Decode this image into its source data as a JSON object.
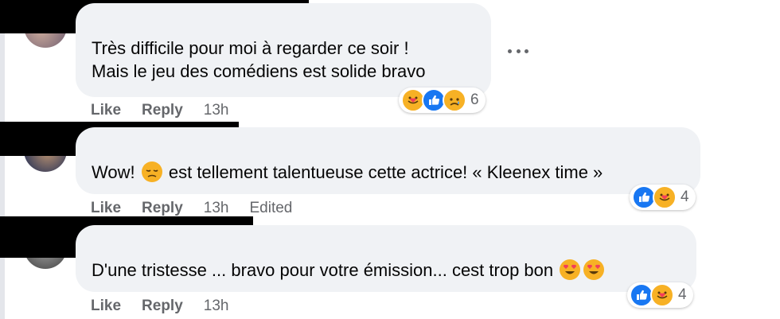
{
  "comments": [
    {
      "text_lines": [
        "Très difficile pour moi à regarder ce soir !",
        "Mais le jeu des comédiens est solide bravo"
      ],
      "actions": {
        "like": "Like",
        "reply": "Reply",
        "time": "13h"
      },
      "reaction_icons": [
        "care-icon",
        "like-icon",
        "sad-icon"
      ],
      "reaction_count": "6",
      "more_icon": "more-options-icon"
    },
    {
      "text_before": "Wow!",
      "inline_emoji": "disappointed-emoji",
      "text_after": "est tellement talentueuse cette actrice! « Kleenex time »",
      "actions": {
        "like": "Like",
        "reply": "Reply",
        "time": "13h",
        "edited": "Edited"
      },
      "reaction_icons": [
        "like-icon",
        "care-icon"
      ],
      "reaction_count": "4"
    },
    {
      "text": "D'une tristesse ... bravo pour votre émission... cest trop bon",
      "trailing_emojis": [
        "heart-eyes-emoji",
        "heart-eyes-emoji"
      ],
      "actions": {
        "like": "Like",
        "reply": "Reply",
        "time": "13h"
      },
      "reaction_icons": [
        "like-icon",
        "care-icon"
      ],
      "reaction_count": "4"
    }
  ],
  "colors": {
    "bubble": "#f0f2f5",
    "meta": "#65676b",
    "like_blue": "#1877f2",
    "emoji_yellow": "#f7b125",
    "heart_red": "#f33e58"
  }
}
